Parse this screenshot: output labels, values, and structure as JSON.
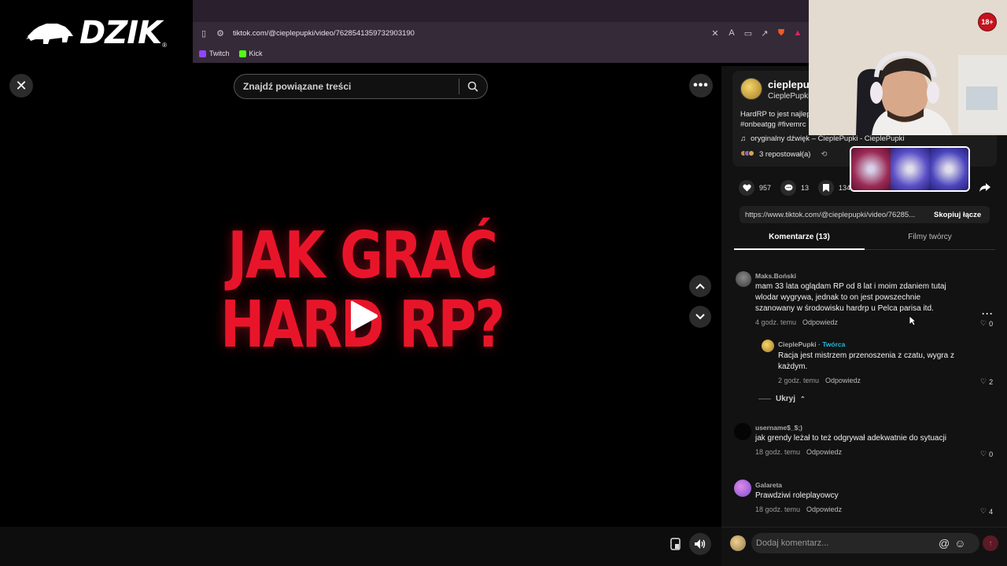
{
  "brand": {
    "logo_text": "DZIK",
    "registered": "®"
  },
  "browser": {
    "url": "tiktok.com/@cieplepupki/video/7628541359732903190",
    "bookmarks": [
      {
        "label": "Twitch",
        "color": "#9146ff"
      },
      {
        "label": "Kick",
        "color": "#53fc18"
      }
    ]
  },
  "player": {
    "search_placeholder": "Znajdź powiązane treści",
    "video_title_line1": "JAK GRAĆ",
    "video_title_line2": "HARD RP?",
    "title_color": "#e8152a"
  },
  "creator": {
    "name": "cieplepup",
    "handle": "CieplePupki",
    "description_line1": "HardRP to jest najlep",
    "description_line2": "#onbeatgg #fivemrc",
    "sound": "oryginalny dźwięk – CieplePupki - CieplePupki",
    "reposts": "3 repostował(a)"
  },
  "stats": {
    "likes": "957",
    "comments": "13",
    "saves": "134"
  },
  "share": {
    "link": "https://www.tiktok.com/@cieplepupki/video/76285...",
    "copy_label": "Skopiuj łącze"
  },
  "tabs": {
    "comments": "Komentarze (13)",
    "creator_videos": "Filmy twórcy"
  },
  "comments": [
    {
      "user": "Maks.Boński",
      "text_lines": [
        "mam 33 lata oglądam RP od 8 lat i moim zdaniem tutaj",
        "wlodar wygrywa, jednak to on jest powszechnie",
        "szanowany w środowisku hardrp u Pelca parisa itd."
      ],
      "time": "4 godz. temu",
      "reply": "Odpowiedz",
      "likes": "0"
    },
    {
      "user": "CieplePupki",
      "creator_tag": " · Twórca",
      "text_lines": [
        "Racja jest mistrzem przenoszenia z czatu, wygra z",
        "każdym."
      ],
      "time": "2 godz. temu",
      "reply": "Odpowiedz",
      "likes": "2"
    },
    {
      "user": "username$_$;)",
      "text_lines": [
        "jak grendy leżał to też odgrywał adekwatnie do sytuacji"
      ],
      "time": "18 godz. temu",
      "reply": "Odpowiedz",
      "likes": "0"
    },
    {
      "user": "Galareta",
      "text_lines": [
        "Prawdziwi roleplayowcy"
      ],
      "time": "18 godz. temu",
      "reply": "Odpowiedz",
      "likes": "4"
    }
  ],
  "hide_replies": "Ukryj",
  "comment_input_placeholder": "Dodaj komentarz...",
  "webcam": {
    "age_badge": "18+"
  },
  "icons": [
    "close-icon",
    "search-icon",
    "more-icon",
    "chevron-up-icon",
    "chevron-down-icon",
    "play-icon",
    "pip-icon",
    "volume-icon",
    "heart-icon",
    "comment-icon",
    "bookmark-icon",
    "share-icon",
    "music-icon",
    "repost-icon",
    "at-icon",
    "emoji-icon",
    "send-icon"
  ]
}
